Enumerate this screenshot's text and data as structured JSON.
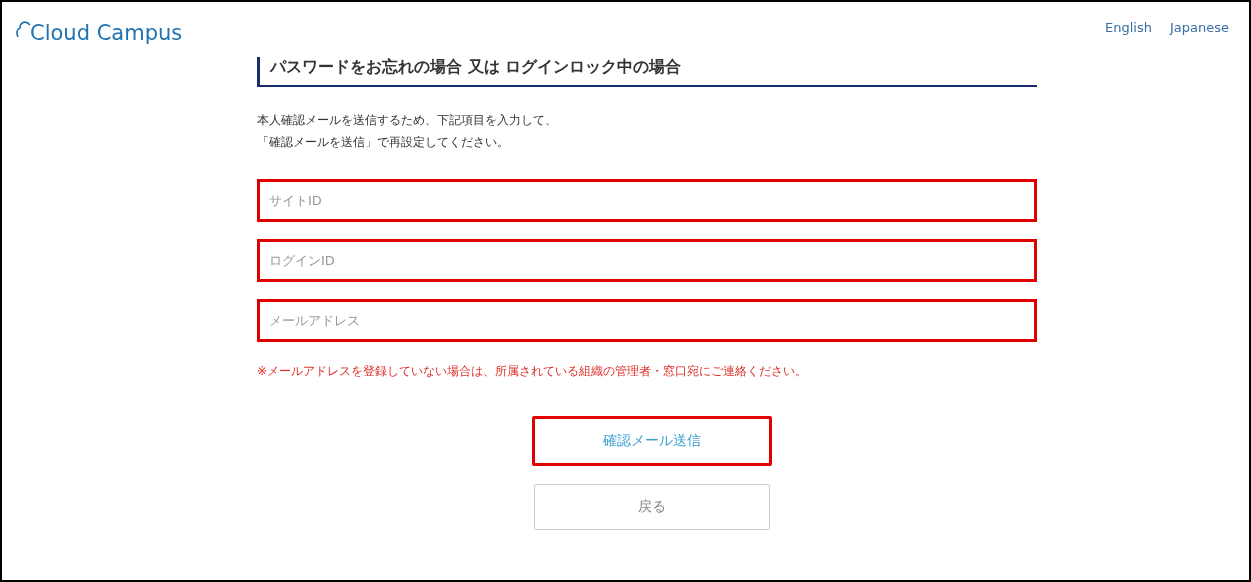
{
  "header": {
    "logo": "Cloud Campus",
    "languages": [
      {
        "label": "English"
      },
      {
        "label": "Japanese"
      }
    ]
  },
  "form": {
    "title": "パスワードをお忘れの場合 又は ログインロック中の場合",
    "instructions": [
      "本人確認メールを送信するため、下記項目を入力して、",
      "「確認メールを送信」で再設定してください。"
    ],
    "fields": [
      {
        "placeholder": "サイトID",
        "highlighted": true
      },
      {
        "placeholder": "ログインID",
        "highlighted": true
      },
      {
        "placeholder": "メールアドレス",
        "highlighted": true
      }
    ],
    "notice": "※メールアドレスを登録していない場合は、所属されている組織の管理者・窓口宛にご連絡ください。",
    "buttons": [
      {
        "label": "確認メール送信",
        "kind": "primary",
        "highlighted": true
      },
      {
        "label": "戻る",
        "kind": "secondary",
        "highlighted": false
      }
    ]
  }
}
